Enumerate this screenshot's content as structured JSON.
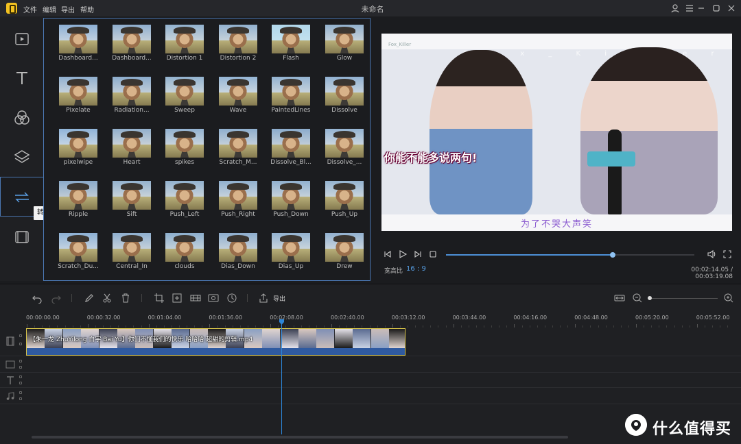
{
  "app": {
    "window_title": "未命名",
    "menu": [
      "文件",
      "编辑",
      "导出",
      "帮助"
    ]
  },
  "sidebar": {
    "items": [
      {
        "icon": "media-icon"
      },
      {
        "icon": "text-icon"
      },
      {
        "icon": "filter-icon"
      },
      {
        "icon": "overlay-icon"
      },
      {
        "icon": "transition-icon",
        "tooltip": "转场",
        "active": true
      },
      {
        "icon": "film-element-icon"
      }
    ]
  },
  "transitions": [
    {
      "label": "Dashboard..."
    },
    {
      "label": "Dashboard..."
    },
    {
      "label": "Distortion 1"
    },
    {
      "label": "Distortion 2"
    },
    {
      "label": "Flash"
    },
    {
      "label": "Glow"
    },
    {
      "label": "Pixelate"
    },
    {
      "label": "Radiation..."
    },
    {
      "label": "Sweep"
    },
    {
      "label": "Wave"
    },
    {
      "label": "PaintedLines"
    },
    {
      "label": "Dissolve"
    },
    {
      "label": "pixelwipe"
    },
    {
      "label": "Heart"
    },
    {
      "label": "spikes"
    },
    {
      "label": "Scratch_M..."
    },
    {
      "label": "Dissolve_Bl..."
    },
    {
      "label": "Dissolve_..."
    },
    {
      "label": "Ripple"
    },
    {
      "label": "Sift"
    },
    {
      "label": "Push_Left"
    },
    {
      "label": "Push_Right"
    },
    {
      "label": "Push_Down"
    },
    {
      "label": "Push_Up"
    },
    {
      "label": "Scratch_Du..."
    },
    {
      "label": "Central_In"
    },
    {
      "label": "clouds"
    },
    {
      "label": "Dias_Down"
    },
    {
      "label": "Dias_Up"
    },
    {
      "label": "Drew"
    }
  ],
  "preview": {
    "watermark": "Fox_Killer",
    "watermark_letters": "F o x _ K i l l e r",
    "caption": "你能不能多说两句!",
    "subtitle": "为了不哭大声笑",
    "progress": 0.67,
    "ratio_label": "宽高比",
    "ratio_value": "16 : 9",
    "time": "00:02:14.05 / 00:03:19.08"
  },
  "timeline": {
    "export_label": "导出",
    "zoom": 0.02,
    "ruler": [
      "00:00:00.00",
      "00:00:32.00",
      "00:01:04.00",
      "00:01:36.00",
      "00:02:08.00",
      "00:02:40.00",
      "00:03:12.00",
      "00:03:44.00",
      "00:04:16.00",
      "00:04:48.00",
      "00:05:20.00",
      "00:05:52.00"
    ],
    "clip_title": "【朱一龙 ZhuYilong 白宇 Bai Yu】你们不懂我们的快乐 哈哈哈 超甜的剪辑.mp4",
    "tracks": [
      "video-track",
      "pip-track",
      "text-track",
      "music-track"
    ]
  },
  "brand": {
    "name": "什么值得买"
  }
}
